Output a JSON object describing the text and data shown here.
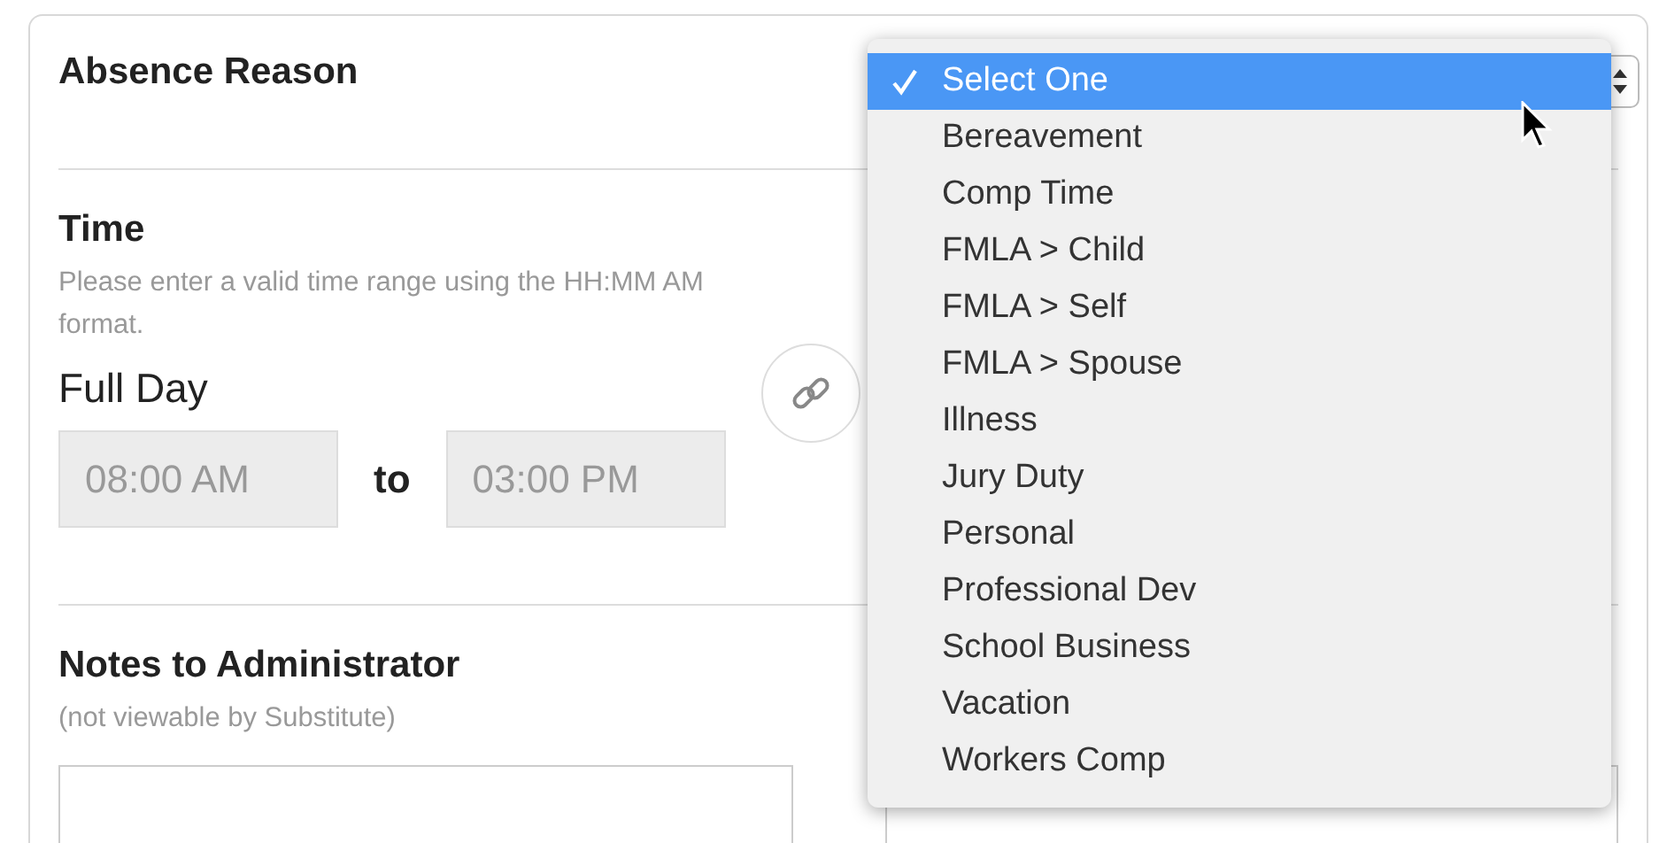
{
  "absence_reason": {
    "label": "Absence Reason",
    "dropdown": {
      "options": [
        {
          "label": "Select One",
          "selected": true
        },
        {
          "label": "Bereavement",
          "selected": false
        },
        {
          "label": "Comp Time",
          "selected": false
        },
        {
          "label": "FMLA > Child",
          "selected": false
        },
        {
          "label": "FMLA > Self",
          "selected": false
        },
        {
          "label": "FMLA > Spouse",
          "selected": false
        },
        {
          "label": "Illness",
          "selected": false
        },
        {
          "label": "Jury Duty",
          "selected": false
        },
        {
          "label": "Personal",
          "selected": false
        },
        {
          "label": "Professional Dev",
          "selected": false
        },
        {
          "label": "School Business",
          "selected": false
        },
        {
          "label": "Vacation",
          "selected": false
        },
        {
          "label": "Workers Comp",
          "selected": false
        }
      ]
    }
  },
  "time": {
    "label": "Time",
    "hint": "Please enter a valid time range using the HH:MM AM format.",
    "day_label": "Full Day",
    "start": {
      "value": "08:00 AM",
      "disabled": true
    },
    "separator": "to",
    "end": {
      "value": "03:00 PM",
      "disabled": true
    }
  },
  "notes": {
    "label": "Notes to Administrator",
    "hint": "(not viewable by Substitute)"
  }
}
